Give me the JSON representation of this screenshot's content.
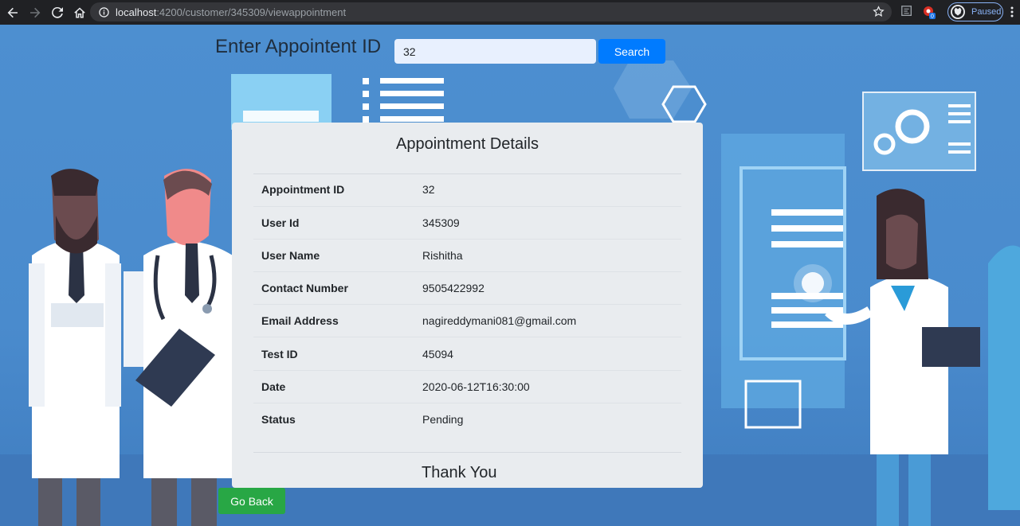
{
  "browser": {
    "url_host": "localhost",
    "url_rest": ":4200/customer/345309/viewappointment",
    "profile_label": "Paused",
    "extension_badge": "0"
  },
  "search": {
    "label": "Enter Appointent ID",
    "value": "32",
    "button_label": "Search"
  },
  "card": {
    "title": "Appointment Details",
    "rows": [
      {
        "key": "Appointment ID",
        "value": "32"
      },
      {
        "key": "User Id",
        "value": "345309"
      },
      {
        "key": "User Name",
        "value": "Rishitha"
      },
      {
        "key": "Contact Number",
        "value": "9505422992"
      },
      {
        "key": "Email Address",
        "value": "nagireddymani081@gmail.com"
      },
      {
        "key": "Test ID",
        "value": "45094"
      },
      {
        "key": "Date",
        "value": "2020-06-12T16:30:00"
      },
      {
        "key": "Status",
        "value": "Pending"
      }
    ],
    "footer": "Thank You"
  },
  "go_back_label": "Go Back",
  "colors": {
    "primary": "#007bff",
    "success": "#28a745",
    "background": "#4a8bcd",
    "card": "#e9ecef"
  }
}
